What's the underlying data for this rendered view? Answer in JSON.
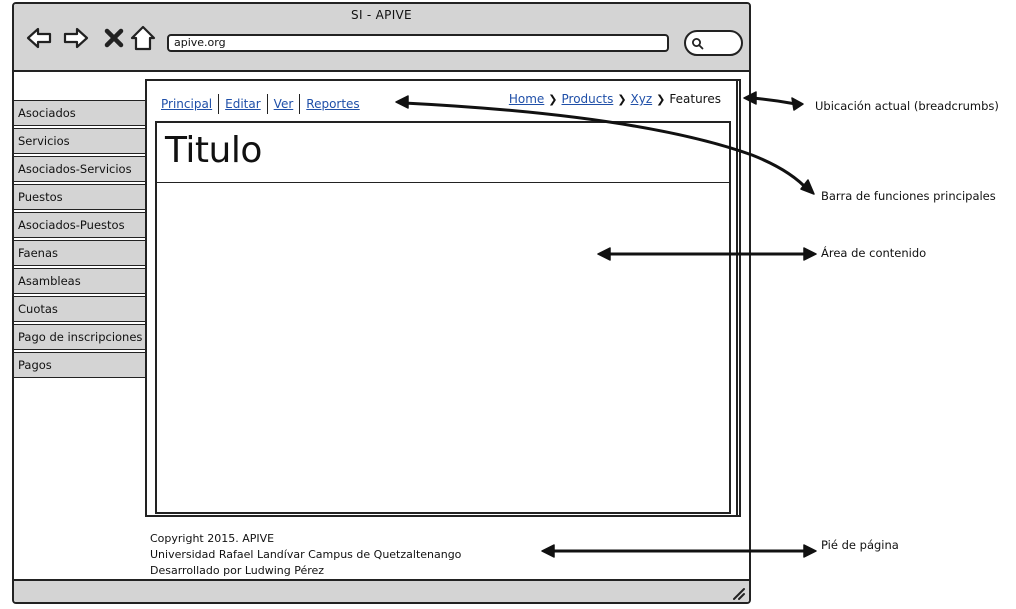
{
  "window": {
    "title": "SI - APIVE",
    "url": "apive.org"
  },
  "icons": {
    "back": "arrow-left-icon",
    "forward": "arrow-right-icon",
    "stop": "close-icon",
    "home": "home-icon",
    "search": "search-icon",
    "resize": "resize-grip-icon"
  },
  "sidebar": {
    "items": [
      {
        "label": "Asociados"
      },
      {
        "label": "Servicios"
      },
      {
        "label": "Asociados-Servicios"
      },
      {
        "label": "Puestos"
      },
      {
        "label": "Asociados-Puestos"
      },
      {
        "label": "Faenas"
      },
      {
        "label": "Asambleas"
      },
      {
        "label": "Cuotas"
      },
      {
        "label": "Pago de inscripciones"
      },
      {
        "label": "Pagos"
      }
    ]
  },
  "function_bar": {
    "items": [
      {
        "label": "Principal"
      },
      {
        "label": "Editar"
      },
      {
        "label": "Ver"
      },
      {
        "label": "Reportes"
      }
    ]
  },
  "breadcrumb": {
    "links": [
      {
        "label": "Home"
      },
      {
        "label": "Products"
      },
      {
        "label": "Xyz"
      }
    ],
    "current": "Features"
  },
  "content": {
    "title": "Titulo"
  },
  "footer": {
    "line1": "Copyright 2015.  APIVE",
    "line2": "Universidad Rafael Landívar Campus de Quetzaltenango",
    "line3": "Desarrollado por Ludwing Pérez"
  },
  "annotations": {
    "breadcrumbs": "Ubicación actual (breadcrumbs)",
    "function_bar": "Barra de funciones principales",
    "content_area": "Área de contenido",
    "footer": "Pié de página"
  },
  "colors": {
    "chrome": "#d4d4d4",
    "link": "#1f4fa8",
    "stroke": "#222222"
  }
}
